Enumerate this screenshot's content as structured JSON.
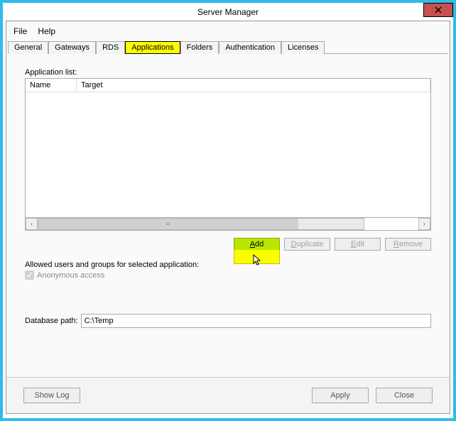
{
  "window": {
    "title": "Server Manager"
  },
  "menu": {
    "file": "File",
    "help": "Help"
  },
  "tabs": {
    "general": "General",
    "gateways": "Gateways",
    "rds": "RDS",
    "applications": "Applications",
    "folders": "Folders",
    "authentication": "Authentication",
    "licenses": "Licenses"
  },
  "app_list": {
    "label": "Application list:",
    "columns": {
      "name": "Name",
      "target": "Target"
    },
    "rows": []
  },
  "buttons": {
    "add": "Add",
    "duplicate": "Duplicate",
    "edit": "Edit",
    "remove": "Remove",
    "show_log": "Show Log",
    "apply": "Apply",
    "close": "Close"
  },
  "allowed": {
    "label": "Allowed users and groups for selected application:",
    "anonymous": "Anonymous access"
  },
  "db": {
    "label": "Database path:",
    "value": "C:\\Temp"
  }
}
